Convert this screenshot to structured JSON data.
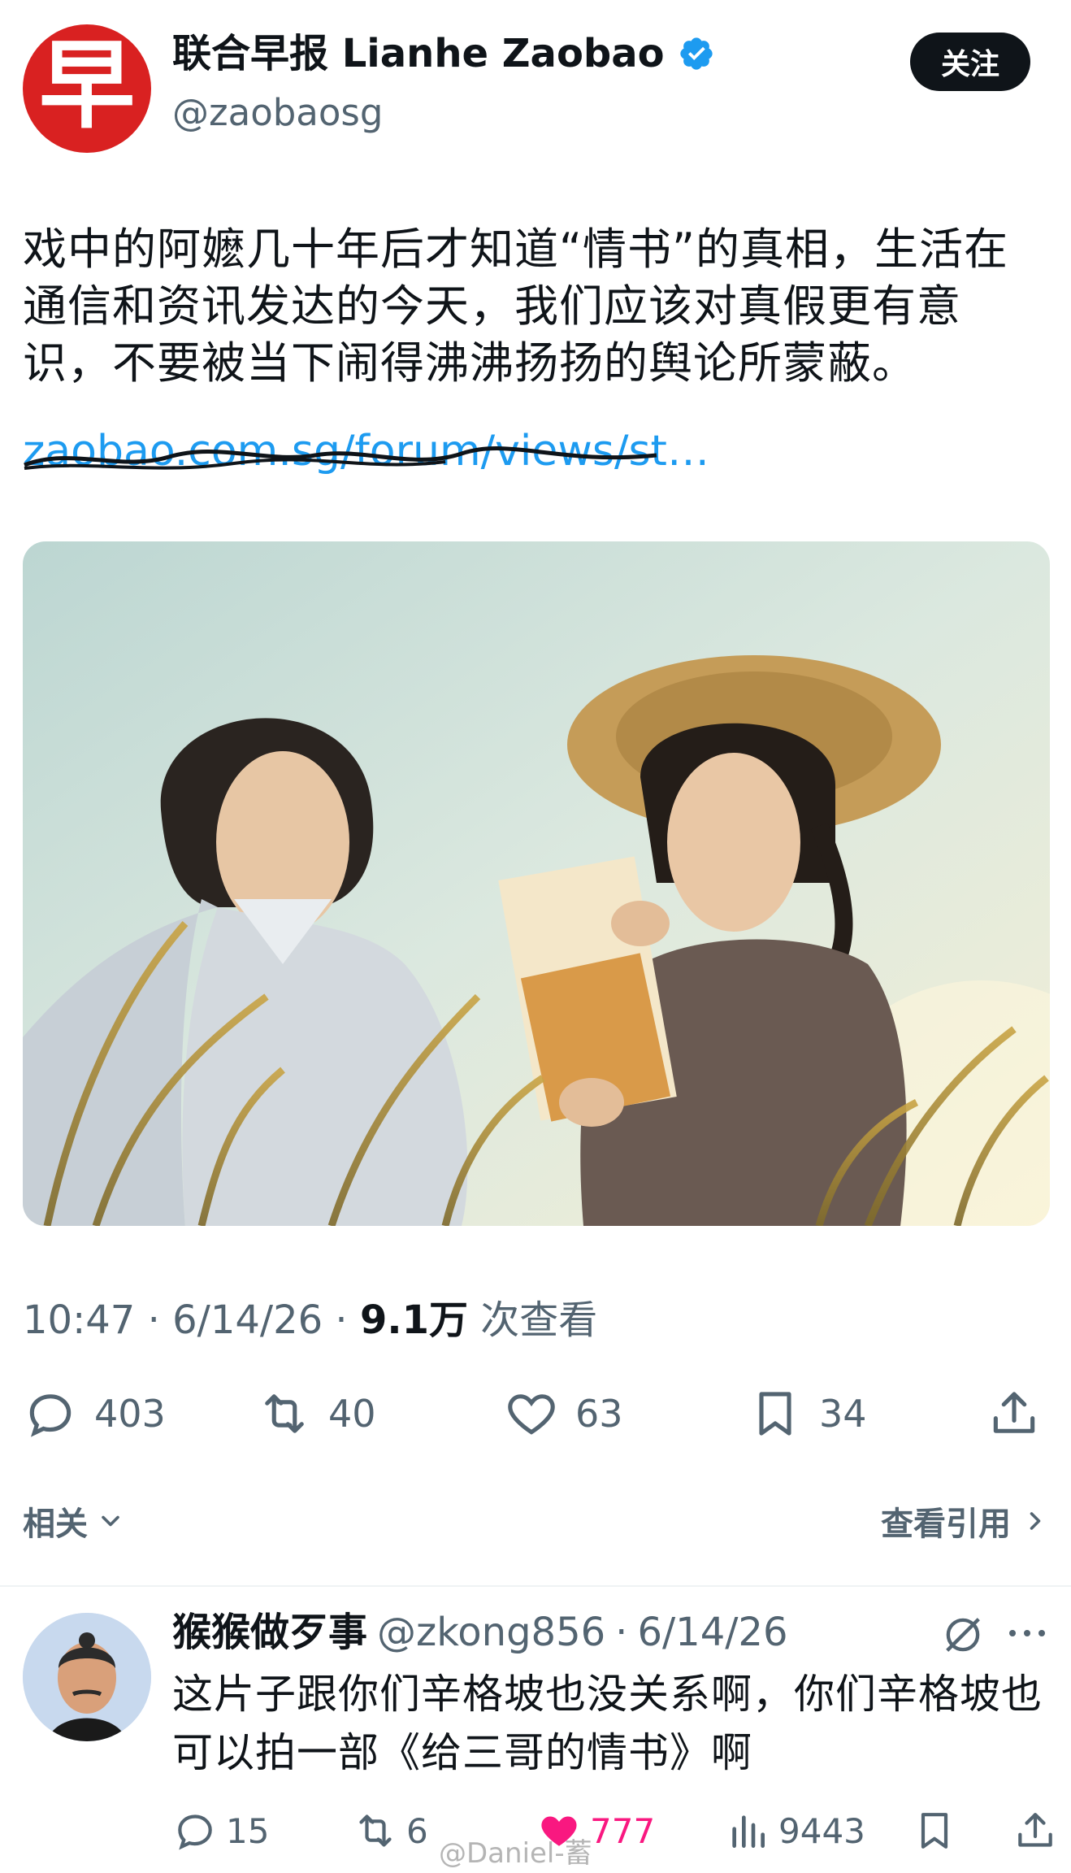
{
  "tweet": {
    "author_name": "联合早报 Lianhe Zaobao",
    "handle": "@zaobaosg",
    "avatar_glyph": "早",
    "follow_label": "关注",
    "text": "戏中的阿嬷几十年后才知道“情书”的真相，生活在通信和资讯发达的今天，我们应该对真假更有意识，不要被当下闹得沸沸扬扬的舆论所蒙蔽。",
    "link_text": "zaobao.com.sg/forum/views/st…",
    "time": "10:47",
    "date": "6/14/26",
    "views_count": "9.1万",
    "views_label": "次查看",
    "replies": "403",
    "retweets": "40",
    "likes": "63",
    "bookmarks": "34"
  },
  "related": {
    "label": "相关",
    "view_quotes_label": "查看引用"
  },
  "reply": {
    "author_name": "猴猴做歹事",
    "handle": "@zkong856",
    "date": "6/14/26",
    "text": "这片子跟你们辛格坡也没关系啊，你们辛格坡也可以拍一部《给三哥的情书》啊",
    "replies": "15",
    "retweets": "6",
    "likes": "777",
    "views": "9443"
  },
  "watermark": "@Daniel-蓄",
  "colors": {
    "accent": "#1d9bf0",
    "brand_red": "#d92121",
    "like_pink": "#f91880",
    "muted": "#536471"
  }
}
